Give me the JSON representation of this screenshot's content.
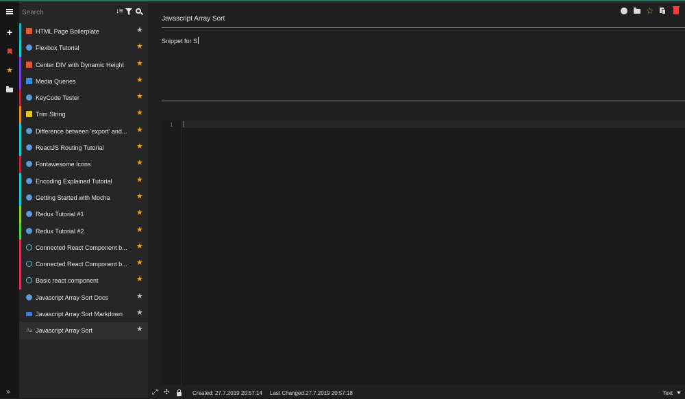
{
  "colors": {
    "accent": "#2f6f6a",
    "star_active": "#f0a020",
    "star_inactive": "#bdbdbd",
    "danger": "#e5413a"
  },
  "rail": {
    "items": [
      {
        "name": "menu-icon"
      },
      {
        "name": "plus-icon",
        "glyph": "+"
      },
      {
        "name": "bookmark-icon"
      },
      {
        "name": "favorites-star-icon",
        "glyph": "★"
      },
      {
        "name": "folder-icon"
      }
    ],
    "expand_glyph": "»"
  },
  "search": {
    "placeholder": "Search",
    "value": ""
  },
  "list_header_icons": [
    "sort-icon",
    "filter-icon",
    "search-icon"
  ],
  "snippets": [
    {
      "title": "HTML Page Boilerplate",
      "language": "html",
      "bar_color": "#2aa7c9",
      "favorite": false
    },
    {
      "title": "Flexbox Tutorial",
      "language": "globe",
      "bar_color": "#19c7d9",
      "favorite": true
    },
    {
      "title": "Center DIV with Dynamic Height",
      "language": "html",
      "bar_color": "#7a3fd1",
      "favorite": true
    },
    {
      "title": "Media Queries",
      "language": "css",
      "bar_color": "#7a3fd1",
      "favorite": true
    },
    {
      "title": "KeyCode Tester",
      "language": "globe",
      "bar_color": "#a82a3c",
      "favorite": true
    },
    {
      "title": "Trim String",
      "language": "js",
      "bar_color": "#e08a1e",
      "favorite": true
    },
    {
      "title": "Difference between 'export' and...",
      "language": "globe",
      "bar_color": "#19c7d9",
      "favorite": true
    },
    {
      "title": "ReactJS Routing Tutorial",
      "language": "globe",
      "bar_color": "#19c7d9",
      "favorite": true
    },
    {
      "title": "Fontawesome Icons",
      "language": "globe",
      "bar_color": "#b52a3a",
      "favorite": true
    },
    {
      "title": "Encoding Explained Tutorial",
      "language": "globe",
      "bar_color": "#19c7d9",
      "favorite": true
    },
    {
      "title": "Getting Started with Mocha",
      "language": "globe",
      "bar_color": "#19c7d9",
      "favorite": true
    },
    {
      "title": "Redux Tutorial #1",
      "language": "globe",
      "bar_color": "#8ad12a",
      "favorite": true
    },
    {
      "title": "Redux Tutorial #2",
      "language": "globe",
      "bar_color": "#5bd14a",
      "favorite": true
    },
    {
      "title": "Connected React Component b...",
      "language": "react",
      "bar_color": "#d6335a",
      "favorite": true
    },
    {
      "title": "Connected React Component b...",
      "language": "react",
      "bar_color": "#d6335a",
      "favorite": true
    },
    {
      "title": "Basic react component",
      "language": "react",
      "bar_color": "#d6335a",
      "favorite": true
    },
    {
      "title": "Javascript Array Sort Docs",
      "language": "globe",
      "bar_color": "",
      "favorite": false
    },
    {
      "title": "Javascript Array Sort Markdown",
      "language": "md",
      "bar_color": "",
      "favorite": false
    },
    {
      "title": "Javascript Array Sort",
      "language": "text",
      "bar_color": "",
      "favorite": false,
      "active": true
    }
  ],
  "snippet": {
    "title": "Javascript Array Sort",
    "description": "Snippet for S",
    "line_numbers": [
      "1"
    ],
    "created_label": "Created:",
    "created": "27.7.2019 20:57:14",
    "changed_label": "Last Changed:",
    "changed": "27.7.2019 20:57:18",
    "mode": "Text"
  },
  "toolbar_icons": [
    "globe-icon",
    "folder-icon",
    "star-outline-icon",
    "copy-icon",
    "trash-icon"
  ]
}
